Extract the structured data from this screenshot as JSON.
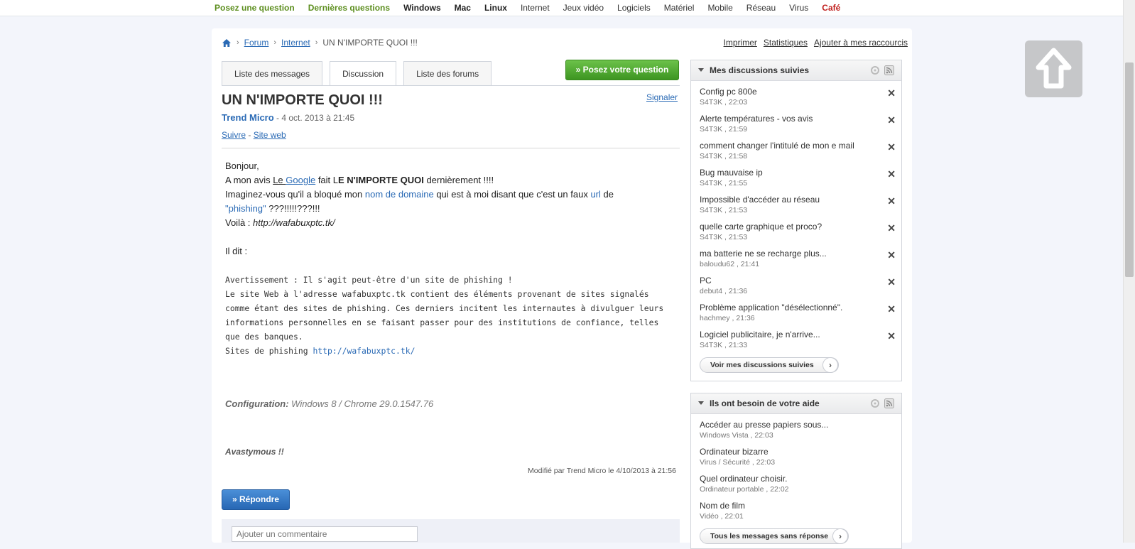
{
  "top_nav": [
    "Posez une question",
    "Dernières questions",
    "Windows",
    "Mac",
    "Linux",
    "Internet",
    "Jeux vidéo",
    "Logiciels",
    "Matériel",
    "Mobile",
    "Réseau",
    "Virus",
    "Café"
  ],
  "breadcrumb": {
    "forum": "Forum",
    "internet": "Internet",
    "current": "UN N'IMPORTE QUOI !!!"
  },
  "toolbar": {
    "print": "Imprimer",
    "stats": "Statistiques",
    "shortcut": "Ajouter à mes raccourcis"
  },
  "tabs": [
    "Liste des messages",
    "Discussion",
    "Liste des forums"
  ],
  "ask_button": "» Posez votre question",
  "post": {
    "title": "UN N'IMPORTE QUOI !!!",
    "report": "Signaler",
    "author": "Trend Micro",
    "date": "- 4 oct. 2013 à 21:45",
    "follow": "Suivre",
    "dash": "-",
    "website": "Site web",
    "greeting": "Bonjour,",
    "l2_a": "A mon avis ",
    "l2_le": "Le ",
    "l2_google": "Google",
    "l2_b": " fait L",
    "l2_bold": "E N'IMPORTE QUOI",
    "l2_c": " dernièrement !!!!",
    "l3_a": "Imaginez-vous qu'il a bloqué mon ",
    "l3_domain": "nom de domaine",
    "l3_b": " qui est à moi disant que c'est un faux ",
    "l3_url": "url",
    "l3_c": " de",
    "l4_phishing": "\"phishing\"",
    "l4_rest": " ???!!!!!???!!!",
    "l5_a": "Voilà : ",
    "l5_url": "http://wafabuxptc.tk/",
    "il_dit": "Il dit :",
    "warn_1": "Avertissement : Il s'agit peut-être d'un site de phishing !",
    "warn_2": "Le site Web à l'adresse wafabuxptc.tk contient des éléments provenant de sites signalés",
    "warn_3": "comme étant des sites de phishing. Ces derniers incitent les internautes à divulguer leurs",
    "warn_4": "informations personnelles en se faisant passer pour des institutions de confiance, telles",
    "warn_5": "que des banques.",
    "warn_6a": "Sites de phishing ",
    "warn_6url": "http://wafabuxptc.tk/",
    "config_label": "Configuration:",
    "config_value": " Windows 8 / Chrome 29.0.1547.76",
    "signature": "Avastymous !!",
    "modified": "Modifié par Trend Micro le 4/10/2013 à 21:56"
  },
  "reply_button": "» Répondre",
  "comment_placeholder": "Ajouter un commentaire",
  "followed": {
    "title": "Mes discussions suivies",
    "items": [
      {
        "title": "Config pc 800e",
        "meta": "S4T3K , 22:03"
      },
      {
        "title": "Alerte températures - vos avis",
        "meta": "S4T3K , 21:59"
      },
      {
        "title": "comment changer l'intitulé de mon e mail",
        "meta": "S4T3K , 21:58"
      },
      {
        "title": "Bug mauvaise ip",
        "meta": "S4T3K , 21:55"
      },
      {
        "title": "Impossible d'accéder au réseau",
        "meta": "S4T3K , 21:53"
      },
      {
        "title": "quelle carte graphique et proco?",
        "meta": "S4T3K , 21:53"
      },
      {
        "title": "ma batterie ne se recharge plus...",
        "meta": "baloudu62 , 21:41"
      },
      {
        "title": "PC",
        "meta": "debut4 , 21:36"
      },
      {
        "title": "Problème application \"désélectionné\".",
        "meta": "hachmey , 21:36"
      },
      {
        "title": "Logiciel publicitaire, je n'arrive...",
        "meta": "S4T3K , 21:33"
      }
    ],
    "close_glyph": "✕",
    "more": "Voir mes discussions suivies"
  },
  "help": {
    "title": "Ils ont besoin de votre aide",
    "items": [
      {
        "title": "Accéder au presse papiers sous...",
        "meta": "Windows Vista , 22:03"
      },
      {
        "title": "Ordinateur bizarre",
        "meta": "Virus / Sécurité , 22:03"
      },
      {
        "title": "Quel ordinateur choisir.",
        "meta": "Ordinateur portable , 22:02"
      },
      {
        "title": "Nom de film",
        "meta": "Vidéo , 22:01"
      }
    ],
    "more": "Tous les messages sans réponse"
  },
  "chevron": "›"
}
